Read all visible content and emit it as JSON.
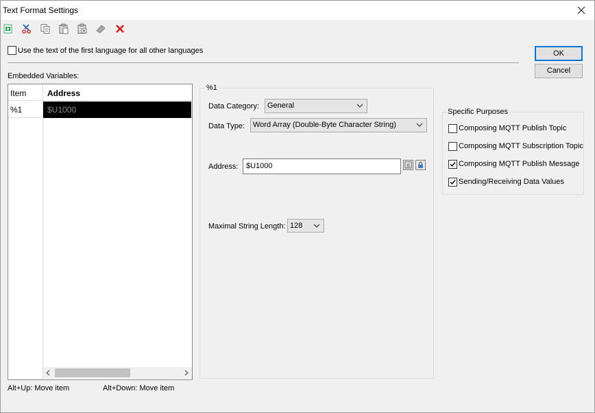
{
  "window": {
    "title": "Text Format Settings"
  },
  "toolbar": {
    "icons": [
      "add-icon",
      "cut-icon",
      "copy-icon",
      "paste-icon",
      "paste-special-icon",
      "eraser-icon",
      "delete-icon"
    ]
  },
  "options": {
    "use_first_language_label": "Use the text of the first language for all other languages",
    "use_first_language_checked": false
  },
  "buttons": {
    "ok": "OK",
    "cancel": "Cancel"
  },
  "variables": {
    "label": "Embedded Variables:",
    "columns": [
      "Item",
      "Address"
    ],
    "rows": [
      {
        "item": "%1",
        "address": "$U1000"
      }
    ]
  },
  "details": {
    "group_title": "%1",
    "data_category_label": "Data Category:",
    "data_category_value": "General",
    "data_type_label": "Data Type:",
    "data_type_value": "Word Array (Double-Byte Character String)",
    "address_label": "Address:",
    "address_value": "$U1000",
    "max_length_label": "Maximal String Length:",
    "max_length_value": "128"
  },
  "purposes": {
    "title": "Specific Purposes",
    "items": [
      {
        "label": "Composing MQTT Publish Topic",
        "checked": false
      },
      {
        "label": "Composing MQTT Subscription Topic",
        "checked": false
      },
      {
        "label": "Composing MQTT Publish Message",
        "checked": true
      },
      {
        "label": "Sending/Receiving Data Values",
        "checked": true
      }
    ]
  },
  "hints": {
    "move_up": "Alt+Up: Move item",
    "move_down": "Alt+Down: Move item"
  },
  "colors": {
    "accent": "#0078d7",
    "selection": "#000000",
    "selection_text": "#8a8a8a"
  }
}
